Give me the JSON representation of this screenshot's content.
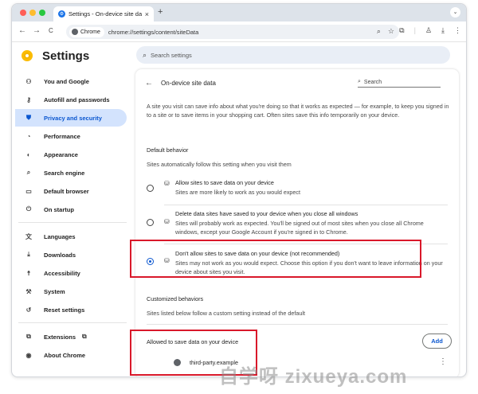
{
  "browser": {
    "tab_title": "Settings - On-device site da",
    "tab_close": "×",
    "new_tab": "+",
    "tab_menu": "⌄",
    "back": "←",
    "forward": "→",
    "reload": "C",
    "chip_label": "Chrome",
    "url": "chrome://settings/content/siteData"
  },
  "header": {
    "title": "Settings",
    "search_placeholder": "Search settings"
  },
  "sidebar": {
    "items": [
      {
        "label": "You and Google",
        "icon": "person-icon"
      },
      {
        "label": "Autofill and passwords",
        "icon": "key-icon"
      },
      {
        "label": "Privacy and security",
        "icon": "shield-icon",
        "active": true
      },
      {
        "label": "Performance",
        "icon": "speedometer-icon"
      },
      {
        "label": "Appearance",
        "icon": "palette-icon"
      },
      {
        "label": "Search engine",
        "icon": "search-icon"
      },
      {
        "label": "Default browser",
        "icon": "browser-icon"
      },
      {
        "label": "On startup",
        "icon": "power-icon"
      },
      {
        "label": "Languages",
        "icon": "translate-icon"
      },
      {
        "label": "Downloads",
        "icon": "download-icon"
      },
      {
        "label": "Accessibility",
        "icon": "accessibility-icon"
      },
      {
        "label": "System",
        "icon": "wrench-icon"
      },
      {
        "label": "Reset settings",
        "icon": "reset-icon"
      },
      {
        "label": "Extensions",
        "icon": "puzzle-icon"
      },
      {
        "label": "About Chrome",
        "icon": "chrome-icon"
      }
    ]
  },
  "main": {
    "title": "On-device site data",
    "search_placeholder": "Search",
    "description": "A site you visit can save info about what you're doing so that it works as expected — for example, to keep you signed in to a site or to save items in your shopping cart. Often sites save this info temporarily on your device.",
    "default_behavior_heading": "Default behavior",
    "default_behavior_sub": "Sites automatically follow this setting when you visit them",
    "options": [
      {
        "label": "Allow sites to save data on your device",
        "desc": "Sites are more likely to work as you would expect",
        "selected": false
      },
      {
        "label": "Delete data sites have saved to your device when you close all windows",
        "desc": "Sites will probably work as expected. You'll be signed out of most sites when you close all Chrome windows, except your Google Account if you're signed in to Chrome.",
        "selected": false
      },
      {
        "label": "Don't allow sites to save data on your device (not recommended)",
        "desc": "Sites may not work as you would expect. Choose this option if you don't want to leave information on your device about sites you visit.",
        "selected": true
      }
    ],
    "customized_heading": "Customized behaviors",
    "customized_sub": "Sites listed below follow a custom setting instead of the default",
    "allowed_heading": "Allowed to save data on your device",
    "add_label": "Add",
    "allowed_sites": [
      "third-party.example"
    ]
  },
  "colors": {
    "accent": "#0b57d0",
    "active_bg": "#d3e3fd",
    "highlight_box": "#d9182a"
  },
  "watermark": "自学呀 zixueya.com"
}
